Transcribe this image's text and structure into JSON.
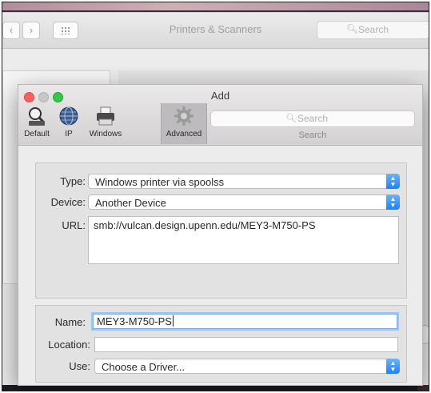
{
  "background_window": {
    "title": "Printers & Scanners",
    "nav_back": "‹",
    "nav_forward": "›",
    "search_placeholder": "Search",
    "search_icon": "search-icon"
  },
  "dialog": {
    "title": "Add",
    "toolbar": [
      {
        "label": "Default",
        "icon": "default-printer-icon"
      },
      {
        "label": "IP",
        "icon": "ip-globe-icon"
      },
      {
        "label": "Windows",
        "icon": "windows-printer-icon"
      },
      {
        "label": "Advanced",
        "icon": "advanced-gear-icon",
        "selected": true
      }
    ],
    "search": {
      "placeholder": "Search",
      "label": "Search"
    },
    "type": {
      "label": "Type:",
      "value": "Windows printer via spoolss"
    },
    "device": {
      "label": "Device:",
      "value": "Another Device"
    },
    "url": {
      "label": "URL:",
      "value": "smb://vulcan.design.upenn.edu/MEY3-M750-PS"
    },
    "name": {
      "label": "Name:",
      "value": "MEY3-M750-PS"
    },
    "location": {
      "label": "Location:",
      "value": ""
    },
    "use": {
      "label": "Use:",
      "value": "Choose a Driver..."
    }
  },
  "colors": {
    "accent": "#1a82fb",
    "close": "#fc605c",
    "zoom": "#34c84a",
    "focus_ring": "#9fc6f3"
  }
}
